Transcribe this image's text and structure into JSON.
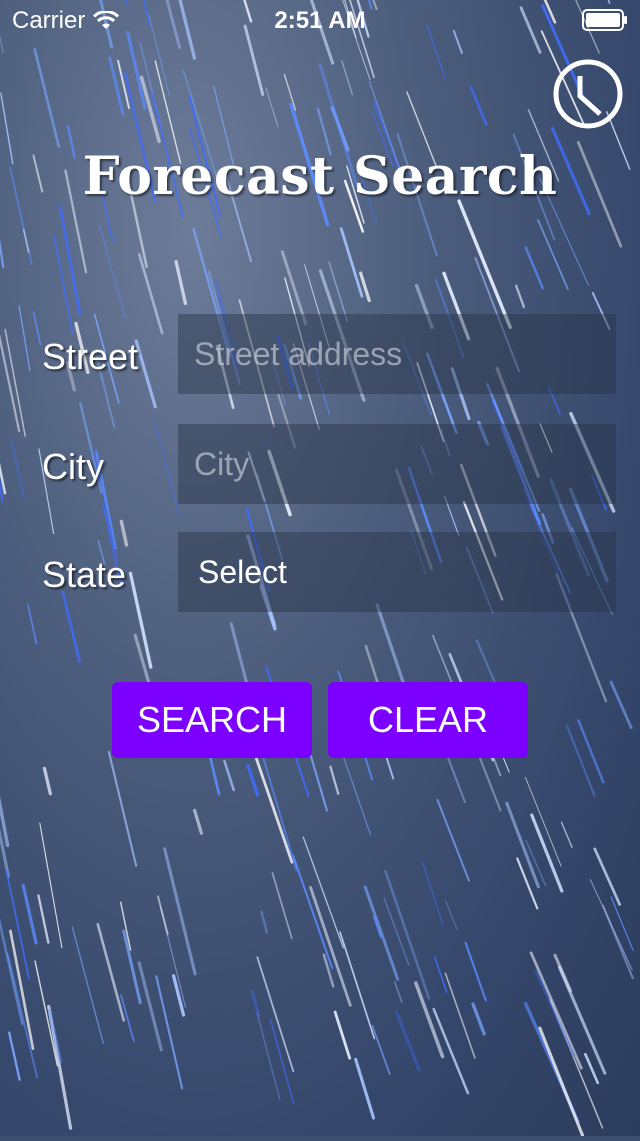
{
  "status_bar": {
    "carrier": "Carrier",
    "time": "2:51 AM"
  },
  "history_icon": "clock-icon",
  "title": "Forecast Search",
  "form": {
    "street": {
      "label": "Street",
      "placeholder": "Street address",
      "value": ""
    },
    "city": {
      "label": "City",
      "placeholder": "City",
      "value": ""
    },
    "state": {
      "label": "State",
      "selected": "Select"
    }
  },
  "buttons": {
    "search_label": "SEARCH",
    "clear_label": "CLEAR"
  },
  "colors": {
    "button_bg": "#7b00ff",
    "text": "#ffffff",
    "background_night_sky": "#3d4f70"
  }
}
